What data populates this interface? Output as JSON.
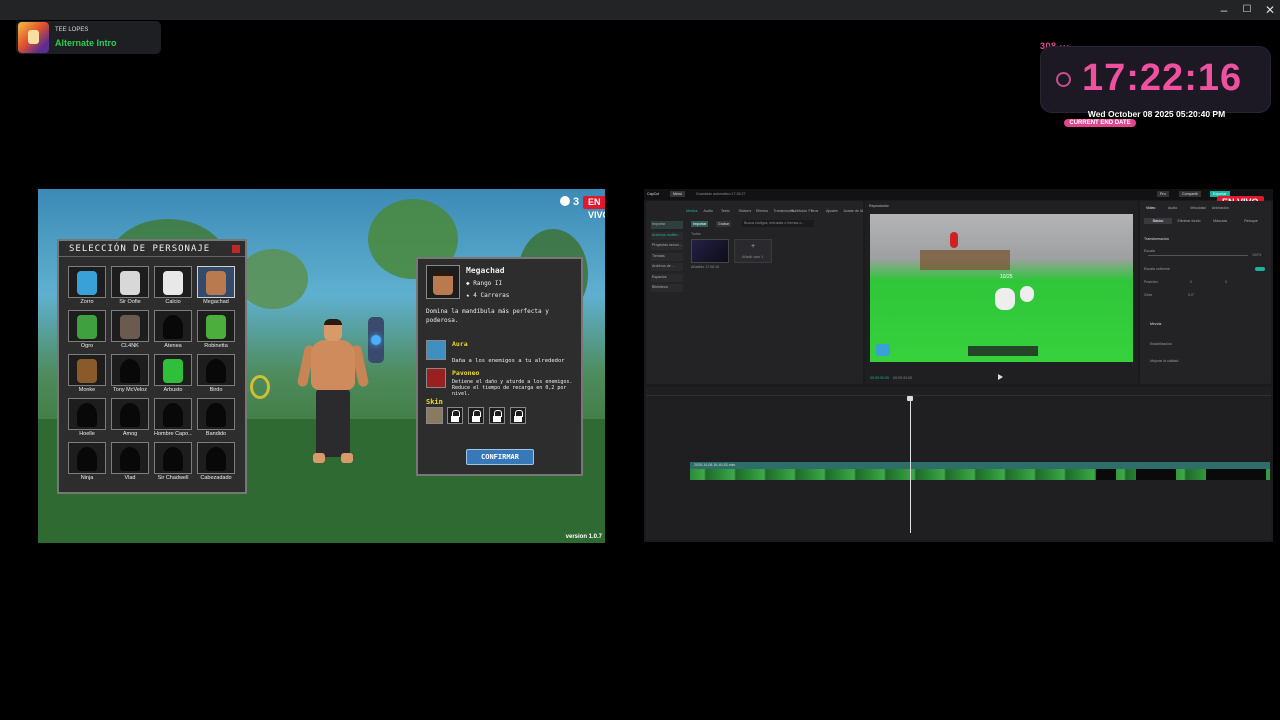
{
  "window": {
    "controls": [
      "minimize-icon",
      "maximize-icon",
      "close-icon"
    ]
  },
  "now_playing": {
    "artist": "TEE LOPES",
    "song": "Alternate Intro",
    "song_color": "#2ecc55"
  },
  "clock": {
    "identifier": "308 ···",
    "time": "17:22:16",
    "date": "Wed October 08 2025 05:20:40 PM",
    "label": "CURRENT END DATE",
    "accent_color": "#f050a0"
  },
  "game": {
    "viewer_count": "3",
    "live_label": "EN VIVO",
    "version": "version 1.0.7",
    "character_select": {
      "title": "SELECCIÓN DE PERSONAJE",
      "characters": [
        {
          "name": "Zorro",
          "color": "#3aa0d8"
        },
        {
          "name": "Sir Oofie",
          "color": "#d8d8d8"
        },
        {
          "name": "Calcio",
          "color": "#e8e8e8"
        },
        {
          "name": "Megachad",
          "color": "#b97a50"
        },
        {
          "name": "Ogro",
          "color": "#3fa040"
        },
        {
          "name": "CL4NK",
          "color": "#6a5a50"
        },
        {
          "name": "Atenea",
          "color": "silhouette"
        },
        {
          "name": "Robinetta",
          "color": "#4cae3c"
        },
        {
          "name": "Monke",
          "color": "#8a5a2a"
        },
        {
          "name": "Tony McVeloz",
          "color": "silhouette"
        },
        {
          "name": "Arbusto",
          "color": "#2fbf3a"
        },
        {
          "name": "Birdo",
          "color": "silhouette"
        },
        {
          "name": "Hoelle",
          "color": "silhouette"
        },
        {
          "name": "Amog",
          "color": "silhouette"
        },
        {
          "name": "Hombre Capo...",
          "color": "silhouette"
        },
        {
          "name": "Bandido",
          "color": "silhouette"
        },
        {
          "name": "Ninja",
          "color": "silhouette"
        },
        {
          "name": "Vlad",
          "color": "silhouette"
        },
        {
          "name": "Sir Chadwell",
          "color": "silhouette"
        },
        {
          "name": "Cabezadado",
          "color": "silhouette"
        }
      ]
    },
    "character_info": {
      "name": "Megachad",
      "rank": "Rango II",
      "races": "4 Carreras",
      "description": "Domina la mandíbula más perfecta y poderosa.",
      "ability1": {
        "name": "Aura",
        "desc": "Daña a los enemigos a tu alrededor"
      },
      "ability2": {
        "name": "Pavoneo",
        "desc": "Detiene el daño y aturde a los enemigos. Reduce el tiempo de recarga en 0,2 por nivel."
      },
      "skin_label": "Skin",
      "confirm_label": "CONFIRMAR"
    }
  },
  "editor": {
    "live_label": "EN VIVO",
    "app_name": "CapCut",
    "menu_button": "Menú",
    "project_title": "Guardado automático 17:26:27",
    "top_buttons": [
      "Pro",
      "Compartir",
      "Exportar"
    ],
    "toolbar": [
      "Medios",
      "Audio",
      "Texto",
      "Stickers",
      "Efectos",
      "Transiciones",
      "Subtítulos",
      "Filtros",
      "Ajustes",
      "Avatar de IA"
    ],
    "left_nav": [
      "Importar",
      "Archivos multim...",
      "Proyectos secun...",
      "Tiendas",
      "Archivos de ...",
      "Espacios",
      "Biblioteca"
    ],
    "media_tabs": [
      "Importar",
      "Grabar"
    ],
    "search_placeholder": "Busca códigos, entradas o formas o...",
    "media_label": "Todos",
    "thumb_caption": "Añadido 17:06:10",
    "add_label": "Añadir cant 1",
    "player_title": "Reproductor",
    "game_hud": "10/25",
    "player_time": "00:00:00:00",
    "player_duration": "00:09:33:05",
    "right_tabs": [
      "Vídeo",
      "Audio",
      "Velocidad",
      "Animación"
    ],
    "right_subtabs": [
      "Básico",
      "Eliminar fondo",
      "Máscara",
      "Retoque"
    ],
    "right_labels": [
      "Transformación",
      "Escala",
      "Escala uniforme",
      "Posición",
      "Girar",
      "Mezcla",
      "Estabilización",
      "Mejorar la calidad"
    ],
    "scale_value": "100%",
    "position_x": "0",
    "position_y": "0",
    "rotation": "0.0°",
    "timeline_clip_label": "2025-10-08 16-40-53.mkv"
  }
}
